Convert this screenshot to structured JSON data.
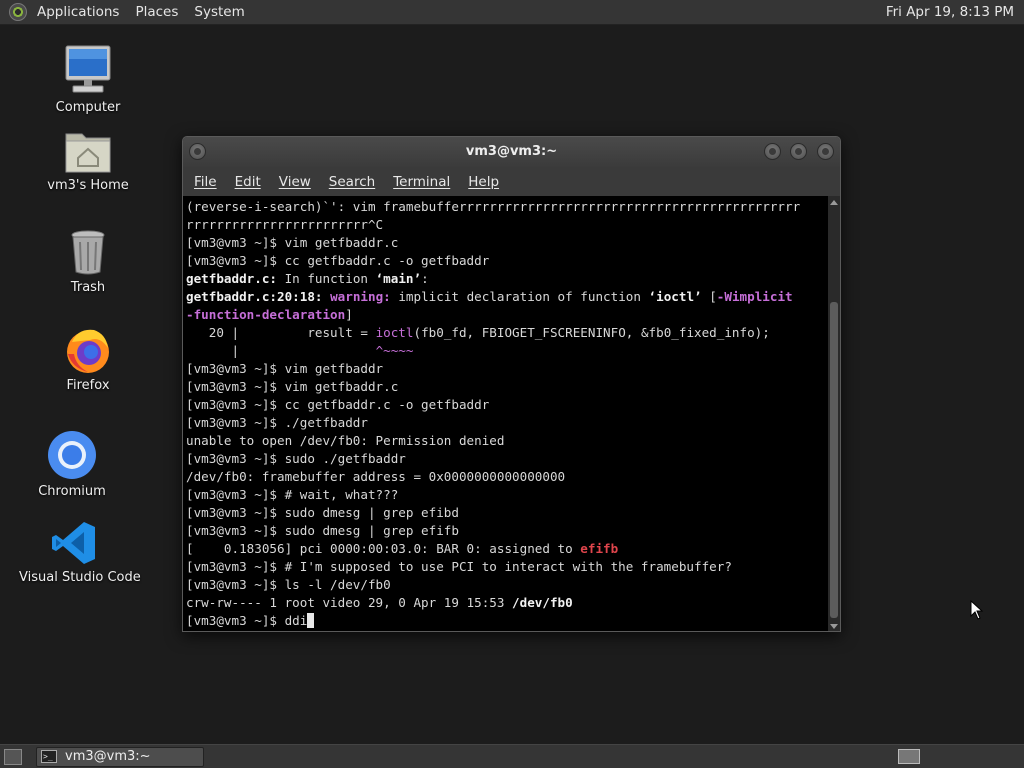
{
  "top_panel": {
    "menus": [
      "Applications",
      "Places",
      "System"
    ],
    "clock": "Fri Apr 19,  8:13 PM"
  },
  "desktop": {
    "icons": [
      {
        "label": "Computer",
        "icon": "computer-icon"
      },
      {
        "label": "vm3's Home",
        "icon": "home-folder-icon"
      },
      {
        "label": "Trash",
        "icon": "trash-icon"
      },
      {
        "label": "Firefox",
        "icon": "firefox-icon"
      },
      {
        "label": "Chromium",
        "icon": "chromium-icon"
      },
      {
        "label": "Visual Studio Code",
        "icon": "vscode-icon"
      }
    ]
  },
  "terminal": {
    "title": "vm3@vm3:~",
    "menu": [
      "File",
      "Edit",
      "View",
      "Search",
      "Terminal",
      "Help"
    ],
    "lines": [
      [
        {
          "t": "(reverse-i-search)`': vim framebufferrrrrrrrrrrrrrrrrrrrrrrrrrrrrrrrrrrrrrrrrrrrr"
        }
      ],
      [
        {
          "t": "rrrrrrrrrrrrrrrrrrrrrrrr^C"
        }
      ],
      [
        {
          "t": "[vm3@vm3 ~]$ vim getfbaddr.c"
        }
      ],
      [
        {
          "t": "[vm3@vm3 ~]$ cc getfbaddr.c -o getfbaddr"
        }
      ],
      [
        {
          "t": "getfbaddr.c:",
          "c": "b"
        },
        {
          "t": " In function "
        },
        {
          "t": "‘main’",
          "c": "b"
        },
        {
          "t": ":"
        }
      ],
      [
        {
          "t": "getfbaddr.c:20:18:",
          "c": "b"
        },
        {
          "t": " "
        },
        {
          "t": "warning:",
          "c": "warn"
        },
        {
          "t": " implicit declaration of function "
        },
        {
          "t": "‘ioctl’",
          "c": "b"
        },
        {
          "t": " ["
        },
        {
          "t": "-Wimplicit",
          "c": "warn"
        }
      ],
      [
        {
          "t": "-function-declaration",
          "c": "warn"
        },
        {
          "t": "]"
        }
      ],
      [
        {
          "t": "   20 |         result = "
        },
        {
          "t": "ioctl",
          "c": "mag"
        },
        {
          "t": "(fb0_fd, FBIOGET_FSCREENINFO, &fb0_fixed_info);"
        }
      ],
      [
        {
          "t": "      |                  "
        },
        {
          "t": "^~~~~",
          "c": "mag"
        }
      ],
      [
        {
          "t": "[vm3@vm3 ~]$ vim getfbaddr"
        }
      ],
      [
        {
          "t": "[vm3@vm3 ~]$ vim getfbaddr.c"
        }
      ],
      [
        {
          "t": "[vm3@vm3 ~]$ cc getfbaddr.c -o getfbaddr"
        }
      ],
      [
        {
          "t": "[vm3@vm3 ~]$ ./getfbaddr"
        }
      ],
      [
        {
          "t": "unable to open /dev/fb0: Permission denied"
        }
      ],
      [
        {
          "t": "[vm3@vm3 ~]$ sudo ./getfbaddr"
        }
      ],
      [
        {
          "t": "/dev/fb0: framebuffer address = 0x0000000000000000"
        }
      ],
      [
        {
          "t": "[vm3@vm3 ~]$ # wait, what???"
        }
      ],
      [
        {
          "t": "[vm3@vm3 ~]$ sudo dmesg | grep efibd"
        }
      ],
      [
        {
          "t": "[vm3@vm3 ~]$ sudo dmesg | grep efifb"
        }
      ],
      [
        {
          "t": "[    0.183056] pci 0000:00:03.0: BAR 0: assigned to "
        },
        {
          "t": "efifb",
          "c": "red"
        }
      ],
      [
        {
          "t": "[vm3@vm3 ~]$ # I'm supposed to use PCI to interact with the framebuffer?"
        }
      ],
      [
        {
          "t": "[vm3@vm3 ~]$ ls -l /dev/fb0"
        }
      ],
      [
        {
          "t": "crw-rw---- 1 root video 29, 0 Apr 19 15:53 "
        },
        {
          "t": "/dev/fb0",
          "c": "b"
        }
      ],
      [
        {
          "t": "[vm3@vm3 ~]$ ddi"
        },
        {
          "cursor": true
        }
      ]
    ]
  },
  "bottom_panel": {
    "task_label": "vm3@vm3:~"
  }
}
